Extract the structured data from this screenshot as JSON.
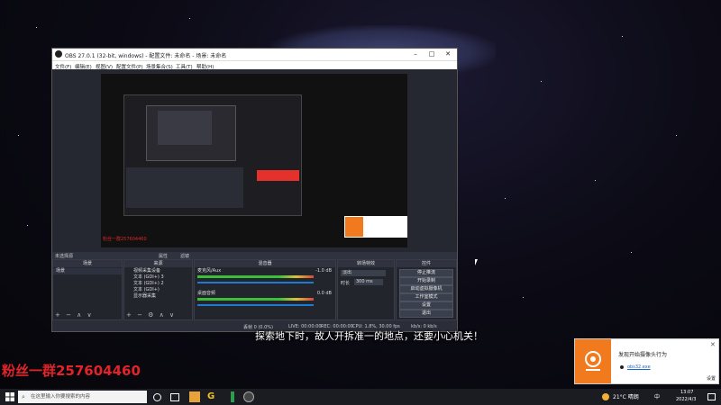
{
  "obs": {
    "title": "OBS 27.0.1 (32-bit, windows) - 配置文件: 未命名 - 场景: 未命名",
    "menu": [
      "文件(F)",
      "编辑(E)",
      "视图(V)",
      "配置文件(P)",
      "场景集合(S)",
      "工具(T)",
      "帮助(H)"
    ],
    "no_source_label": "未选择源",
    "properties_label": "属性",
    "filters_label": "滤镜",
    "preview_overlay_text": "粉丝一群257604460",
    "panels": {
      "scenes": {
        "title": "场景",
        "items": [
          "场景"
        ]
      },
      "sources": {
        "title": "来源",
        "items": [
          "视频采集设备",
          "文本 (GDI+) 3",
          "文本 (GDI+) 2",
          "文本 (GDI+)",
          "显示器采集"
        ]
      },
      "mixer": {
        "title": "混音器",
        "tracks": [
          {
            "name": "麦克风/Aux",
            "db": "-1.0 dB"
          },
          {
            "name": "桌面音频",
            "db": "0.0 dB"
          }
        ]
      },
      "transitions": {
        "title": "转场特效",
        "type": "淡出",
        "duration_label": "时长",
        "duration": "300 ms"
      },
      "controls": {
        "title": "控件",
        "buttons": [
          "停止推流",
          "开始录制",
          "启动虚拟摄像机",
          "工作室模式",
          "设置",
          "退出"
        ]
      }
    },
    "status_bar": {
      "dropped": "丢帧 0 (0.0%)",
      "live": "LIVE: 00:00:00",
      "rec": "REC: 00:00:00",
      "cpu": "CPU: 1.8%, 30.00 fps",
      "kbps": "kb/s: 0 kb/s"
    }
  },
  "subtitle": "探索地下时，故人开拆准一的地点，还要小心机关！",
  "fans_group": "粉丝一群257604460",
  "toast": {
    "title": "发现开始摄像头行为",
    "app": "obs32.exe",
    "action": "设置"
  },
  "taskbar": {
    "search_placeholder": "在这里输入你要搜索的内容",
    "weather": "21°C 晴朗",
    "ime": "中",
    "time": "13:07",
    "date": "2022/4/3"
  },
  "colors": {
    "accent_orange": "#f07a1d",
    "fans_red": "#e0242a",
    "obs_bg": "#2b2e38"
  }
}
